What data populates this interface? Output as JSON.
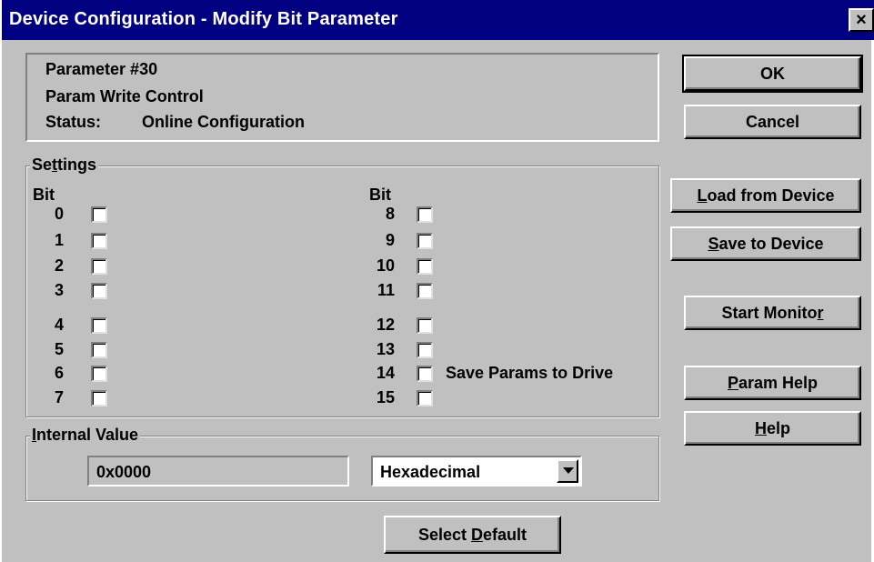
{
  "window": {
    "title": "Device Configuration - Modify Bit Parameter",
    "close_label": "×"
  },
  "info": {
    "param_number": "Parameter #30",
    "param_name": "Param Write Control",
    "status_label": "Status:",
    "status_value": "Online Configuration"
  },
  "settings": {
    "group_label_pre": "Se",
    "group_label_mn": "t",
    "group_label_post": "tings",
    "bit_header_left": "Bit",
    "bit_header_right": "Bit",
    "bits_left": [
      {
        "num": "0",
        "checked": false
      },
      {
        "num": "1",
        "checked": false
      },
      {
        "num": "2",
        "checked": false
      },
      {
        "num": "3",
        "checked": false
      },
      {
        "num": "4",
        "checked": false
      },
      {
        "num": "5",
        "checked": false
      },
      {
        "num": "6",
        "checked": false
      },
      {
        "num": "7",
        "checked": false
      }
    ],
    "bits_right": [
      {
        "num": "8",
        "checked": false
      },
      {
        "num": "9",
        "checked": false
      },
      {
        "num": "10",
        "checked": false
      },
      {
        "num": "11",
        "checked": false
      },
      {
        "num": "12",
        "checked": false
      },
      {
        "num": "13",
        "checked": false
      },
      {
        "num": "14",
        "checked": false,
        "label": "Save Params to Drive"
      },
      {
        "num": "15",
        "checked": false
      }
    ]
  },
  "internal_value": {
    "group_label_mn": "I",
    "group_label_post": "nternal Value",
    "value": "0x0000",
    "format_selected": "Hexadecimal"
  },
  "buttons": {
    "ok": "OK",
    "cancel": "Cancel",
    "load_mn": "L",
    "load_rest": "oad from Device",
    "save_mn": "S",
    "save_rest": "ave to Device",
    "monitor_pre": "Start Monito",
    "monitor_mn": "r",
    "help_param_mn": "P",
    "help_param_rest": "aram Help",
    "help_mn": "H",
    "help_rest": "elp",
    "default_pre": "Select ",
    "default_mn": "D",
    "default_rest": "efault"
  }
}
